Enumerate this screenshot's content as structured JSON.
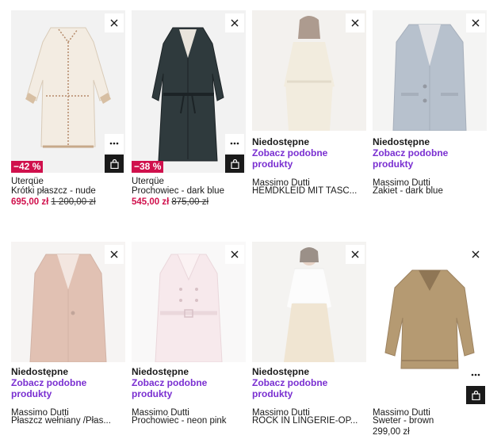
{
  "icons": {
    "close": "close-icon",
    "more": "more-icon",
    "bag": "shopping-bag-icon"
  },
  "colors": {
    "sale": "#d0104c",
    "link": "#7a2fd1",
    "dark": "#1a1a1a"
  },
  "products": [
    {
      "brand": "Uterqüe",
      "name": "Krótki płaszcz - nude",
      "discount": "−42 %",
      "price": "695,00 zł",
      "old_price": "1 200,00 zł"
    },
    {
      "brand": "Uterqüe",
      "name": "Prochowiec - dark blue",
      "discount": "−38 %",
      "price": "545,00 zł",
      "old_price": "875,00 zł"
    },
    {
      "unavailable": "Niedostępne",
      "similar_link": "Zobacz podobne produkty",
      "brand": "Massimo Dutti",
      "name": "HEMDKLEID MIT TASC..."
    },
    {
      "unavailable": "Niedostępne",
      "similar_link": "Zobacz podobne produkty",
      "brand": "Massimo Dutti",
      "name": "Żakiet - dark blue"
    },
    {
      "unavailable": "Niedostępne",
      "similar_link": "Zobacz podobne produkty",
      "brand": "Massimo Dutti",
      "name": "Płaszcz wełniany /Płas..."
    },
    {
      "unavailable": "Niedostępne",
      "similar_link": "Zobacz podobne produkty",
      "brand": "Massimo Dutti",
      "name": "Prochowiec - neon pink"
    },
    {
      "unavailable": "Niedostępne",
      "similar_link": "Zobacz podobne produkty",
      "brand": "Massimo Dutti",
      "name": "ROCK IN LINGERIE-OP..."
    },
    {
      "brand": "Massimo Dutti",
      "name": "Sweter - brown",
      "price": "299,00 zł"
    }
  ]
}
